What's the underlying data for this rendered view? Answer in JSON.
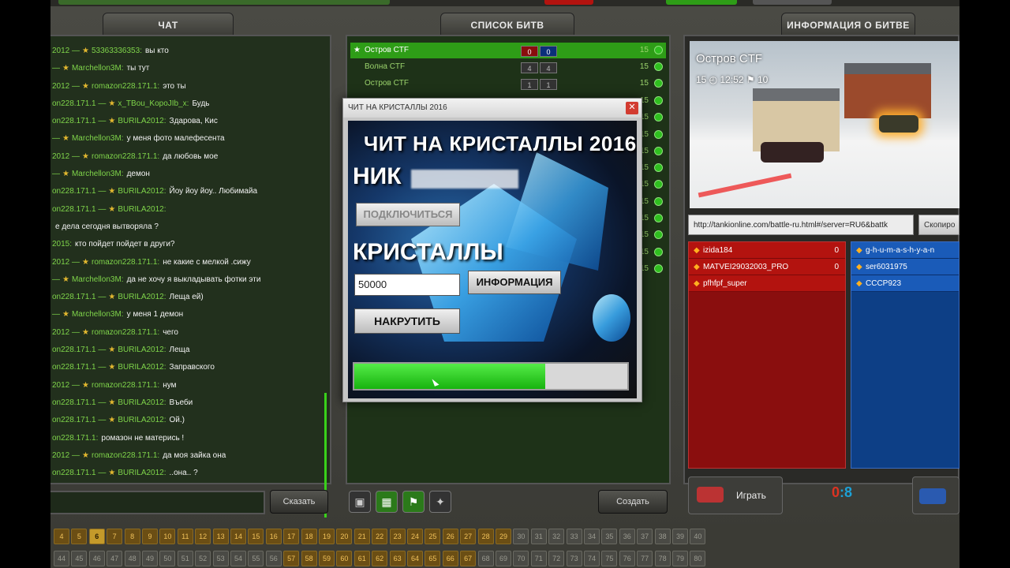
{
  "panels": {
    "chat_title": "ЧАТ",
    "battles_title": "СПИСОК БИТВ",
    "info_title": "ИНФОРМАЦИЯ О БИТВЕ"
  },
  "chat": {
    "messages": [
      {
        "from": "2012",
        "to": "53363336353",
        "text": "вы кто"
      },
      {
        "from": "",
        "to": "Marchellon3M",
        "text": "ты тут"
      },
      {
        "from": "2012",
        "to": "romazon228.171.1",
        "text": "это ты"
      },
      {
        "from": "on228.171.1",
        "to": "x_TBou_KopoJIb_x",
        "text": "Будь"
      },
      {
        "from": "on228.171.1",
        "to": "BURILA2012",
        "text": "Здарова, Кис"
      },
      {
        "from": "",
        "to": "Marchellon3M",
        "text": "у меня фото малефесента"
      },
      {
        "from": "2012",
        "to": "romazon228.171.1",
        "text": "да любовь мое"
      },
      {
        "from": "",
        "to": "Marchellon3M",
        "text": "демон"
      },
      {
        "from": "on228.171.1",
        "to": "BURILA2012",
        "text": "Йоу йоу йоу.. Любимайа"
      },
      {
        "from": "on228.171.1",
        "to": "BURILA2012",
        "text": ""
      },
      {
        "from": "",
        "to": "",
        "text": "е дела сегодня вытворяла ?"
      },
      {
        "from": "2015",
        "to": "",
        "text": "кто пойдет пойдет в други?"
      },
      {
        "from": "2012",
        "to": "romazon228.171.1",
        "text": "не какие с мелкой .сижу"
      },
      {
        "from": "",
        "to": "Marchellon3M",
        "text": "да не хочу я выкладывать фотки эти"
      },
      {
        "from": "on228.171.1",
        "to": "BURILA2012",
        "text": "Леща ей)"
      },
      {
        "from": "",
        "to": "Marchellon3M",
        "text": "у меня 1 демон"
      },
      {
        "from": "2012",
        "to": "romazon228.171.1",
        "text": "чего"
      },
      {
        "from": "on228.171.1",
        "to": "BURILA2012",
        "text": "Леща"
      },
      {
        "from": "on228.171.1",
        "to": "BURILA2012",
        "text": "Заправского"
      },
      {
        "from": "2012",
        "to": "romazon228.171.1",
        "text": "нум"
      },
      {
        "from": "on228.171.1",
        "to": "BURILA2012",
        "text": "Въеби"
      },
      {
        "from": "on228.171.1",
        "to": "BURILA2012",
        "text": "Ой.)"
      },
      {
        "from": "on228.171.1",
        "to": "",
        "text": "ромазон не матерись !"
      },
      {
        "from": "2012",
        "to": "romazon228.171.1",
        "text": "да моя зайка она"
      },
      {
        "from": "on228.171.1",
        "to": "BURILA2012",
        "text": "..она.. ?"
      }
    ],
    "say_button": "Сказать"
  },
  "battles": {
    "rows": [
      {
        "name": "Остров CTF",
        "red": "0",
        "blue": "0",
        "count": "15",
        "selected": true
      },
      {
        "name": "Волна CTF",
        "red": "4",
        "blue": "4",
        "count": "15",
        "selected": false
      },
      {
        "name": "Остров CTF",
        "red": "1",
        "blue": "1",
        "count": "15",
        "selected": false
      }
    ],
    "extra_counts": [
      "15",
      "15",
      "15",
      "15",
      "15",
      "15",
      "15",
      "15",
      "15",
      "15",
      "15"
    ],
    "create_button": "Создать"
  },
  "info": {
    "map_name": "Остров CTF",
    "map_stats": "15  ◴ 12:52  ⚑ 10",
    "url": "http://tankionline.com/battle-ru.html#/server=RU6&battk",
    "copy_button": "Скопиро",
    "red_team": [
      {
        "name": "izida184",
        "score": "0"
      },
      {
        "name": "MATVEI29032003_PRO",
        "score": "0"
      },
      {
        "name": "pfhfpf_super",
        "score": ""
      }
    ],
    "blue_team": [
      {
        "name": "g-h-u-m-a-s-h-y-a-n",
        "score": ""
      },
      {
        "name": "ser6031975",
        "score": ""
      },
      {
        "name": "CCCP923",
        "score": ""
      }
    ],
    "play_button": "Играть",
    "score_red": "0",
    "score_sep": ":",
    "score_blue": "8"
  },
  "pages": {
    "row1": [
      "4",
      "5",
      "6",
      "7",
      "8",
      "9",
      "10",
      "11",
      "12",
      "13",
      "14",
      "15",
      "16",
      "17",
      "18",
      "19",
      "20",
      "21",
      "22",
      "23",
      "24",
      "25",
      "26",
      "27",
      "28",
      "29",
      "30",
      "31",
      "32",
      "33",
      "34",
      "35",
      "36",
      "37",
      "38",
      "39",
      "40"
    ],
    "row2": [
      "44",
      "45",
      "46",
      "47",
      "48",
      "49",
      "50",
      "51",
      "52",
      "53",
      "54",
      "55",
      "56",
      "57",
      "58",
      "59",
      "60",
      "61",
      "62",
      "63",
      "64",
      "65",
      "66",
      "67",
      "68",
      "69",
      "70",
      "71",
      "72",
      "73",
      "74",
      "75",
      "76",
      "77",
      "78",
      "79",
      "80"
    ],
    "current": "6"
  },
  "cheat": {
    "window_title": "ЧИТ НА КРИСТАЛЛЫ 2016",
    "heading": "ЧИТ НА КРИСТАЛЛЫ 2016",
    "nick_label": "НИК",
    "connect_button": "ПОДКЛЮЧИТЬСЯ",
    "crystals_label": "КРИСТАЛЛЫ",
    "crystals_value": "50000",
    "info_button": "ИНФОРМАЦИЯ",
    "boost_button": "НАКРУТИТЬ",
    "progress": 0.7
  },
  "colors": {
    "accent_green": "#2e9d17",
    "red_team": "#8a0e0e",
    "blue_team": "#0d3f86"
  }
}
